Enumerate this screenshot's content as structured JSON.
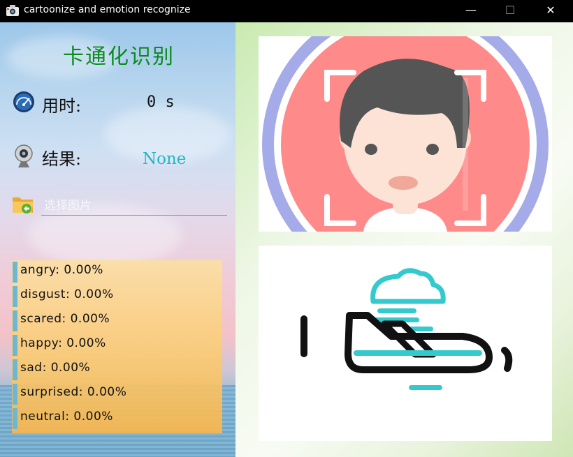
{
  "window": {
    "title": "cartoonize and emotion recognize",
    "minimize_glyph": "—",
    "maximize_glyph": "☐",
    "close_glyph": "✕"
  },
  "app": {
    "title": "卡通化识别",
    "time_label": "用时:",
    "time_value": "0 s",
    "result_label": "结果:",
    "result_value": "None",
    "file_placeholder": "选择图片"
  },
  "emotions": [
    {
      "label": "angry: 0.00%",
      "percent": 0.0
    },
    {
      "label": "disgust: 0.00%",
      "percent": 0.0
    },
    {
      "label": "scared: 0.00%",
      "percent": 0.0
    },
    {
      "label": "happy: 0.00%",
      "percent": 0.0
    },
    {
      "label": "sad: 0.00%",
      "percent": 0.0
    },
    {
      "label": "surprised: 0.00%",
      "percent": 0.0
    },
    {
      "label": "neutral: 0.00%",
      "percent": 0.0
    }
  ],
  "colors": {
    "title_green": "#0c8a1e",
    "result_cyan": "#21b7c2",
    "emotion_bar": "#6cb8d4",
    "face_bg": "#fe8a8a",
    "ring": "#a5abe8",
    "plane_teal": "#34c9cc"
  },
  "icons": {
    "time": "speedometer-icon",
    "result": "webcam-icon",
    "file": "folder-open-icon",
    "preview_top": "face-recognition-illustration",
    "preview_bottom": "airplane-illustration"
  }
}
